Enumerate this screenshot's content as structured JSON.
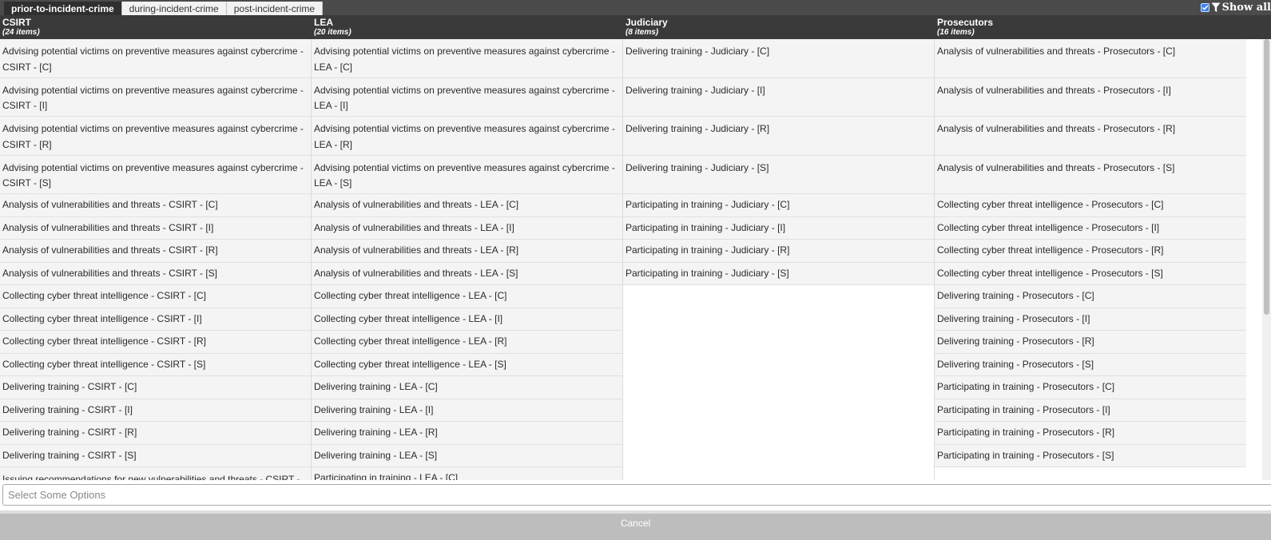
{
  "tabs": [
    {
      "label": "prior-to-incident-crime",
      "active": true
    },
    {
      "label": "during-incident-crime",
      "active": false
    },
    {
      "label": "post-incident-crime",
      "active": false
    }
  ],
  "show_all": {
    "label": "Show all",
    "checked": true
  },
  "columns": [
    {
      "title": "CSIRT",
      "count": "(24 items)",
      "items": [
        "Advising potential victims on preventive measures against cybercrime - CSIRT - [C]",
        "Advising potential victims on preventive measures against cybercrime - CSIRT - [I]",
        "Advising potential victims on preventive measures against cybercrime - CSIRT - [R]",
        "Advising potential victims on preventive measures against cybercrime - CSIRT - [S]",
        "Analysis of vulnerabilities and threats - CSIRT - [C]",
        "Analysis of vulnerabilities and threats - CSIRT - [I]",
        "Analysis of vulnerabilities and threats - CSIRT - [R]",
        "Analysis of vulnerabilities and threats - CSIRT - [S]",
        "Collecting cyber threat intelligence - CSIRT - [C]",
        "Collecting cyber threat intelligence - CSIRT - [I]",
        "Collecting cyber threat intelligence - CSIRT - [R]",
        "Collecting cyber threat intelligence - CSIRT - [S]",
        "Delivering training - CSIRT - [C]",
        "Delivering training - CSIRT - [I]",
        "Delivering training - CSIRT - [R]",
        "Delivering training - CSIRT - [S]",
        "Issuing recommendations for new vulnerabilities and threats - CSIRT - [C]"
      ]
    },
    {
      "title": "LEA",
      "count": "(20 items)",
      "items": [
        "Advising potential victims on preventive measures against cybercrime - LEA - [C]",
        "Advising potential victims on preventive measures against cybercrime - LEA - [I]",
        "Advising potential victims on preventive measures against cybercrime - LEA - [R]",
        "Advising potential victims on preventive measures against cybercrime - LEA - [S]",
        "Analysis of vulnerabilities and threats - LEA - [C]",
        "Analysis of vulnerabilities and threats - LEA - [I]",
        "Analysis of vulnerabilities and threats - LEA - [R]",
        "Analysis of vulnerabilities and threats - LEA - [S]",
        "Collecting cyber threat intelligence - LEA - [C]",
        "Collecting cyber threat intelligence - LEA - [I]",
        "Collecting cyber threat intelligence - LEA - [R]",
        "Collecting cyber threat intelligence - LEA - [S]",
        "Delivering training - LEA - [C]",
        "Delivering training - LEA - [I]",
        "Delivering training - LEA - [R]",
        "Delivering training - LEA - [S]",
        "Participating in training - LEA - [C]"
      ]
    },
    {
      "title": "Judiciary",
      "count": "(8 items)",
      "items": [
        "Delivering training - Judiciary - [C]",
        "Delivering training - Judiciary - [I]",
        "Delivering training - Judiciary - [R]",
        "Delivering training - Judiciary - [S]",
        "Participating in training - Judiciary - [C]",
        "Participating in training - Judiciary - [I]",
        "Participating in training - Judiciary - [R]",
        "Participating in training - Judiciary - [S]"
      ]
    },
    {
      "title": "Prosecutors",
      "count": "(16 items)",
      "items": [
        "Analysis of vulnerabilities and threats - Prosecutors - [C]",
        "Analysis of vulnerabilities and threats - Prosecutors - [I]",
        "Analysis of vulnerabilities and threats - Prosecutors - [R]",
        "Analysis of vulnerabilities and threats - Prosecutors - [S]",
        "Collecting cyber threat intelligence - Prosecutors - [C]",
        "Collecting cyber threat intelligence - Prosecutors - [I]",
        "Collecting cyber threat intelligence - Prosecutors - [R]",
        "Collecting cyber threat intelligence - Prosecutors - [S]",
        "Delivering training - Prosecutors - [C]",
        "Delivering training - Prosecutors - [I]",
        "Delivering training - Prosecutors - [R]",
        "Delivering training - Prosecutors - [S]",
        "Participating in training - Prosecutors - [C]",
        "Participating in training - Prosecutors - [I]",
        "Participating in training - Prosecutors - [R]",
        "Participating in training - Prosecutors - [S]"
      ]
    }
  ],
  "select": {
    "placeholder": "Select Some Options"
  },
  "footer": {
    "cancel_label": "Cancel"
  },
  "colors": {
    "header_bg": "#3a3a3a",
    "tab_active_bg": "#2f2f2f",
    "checkbox": "#3c82f6"
  }
}
